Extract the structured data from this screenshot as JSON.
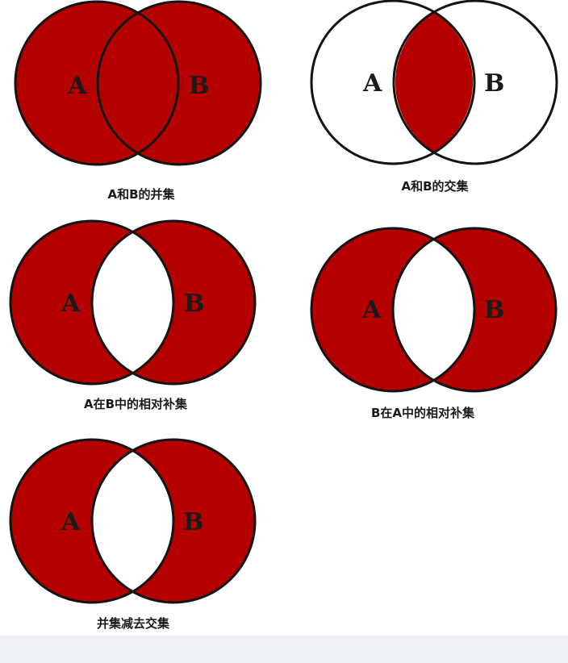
{
  "colors": {
    "fill": "#b50000",
    "stroke": "#141414",
    "label_on_fill": "#1a1a1a",
    "background": "#ffffff"
  },
  "diagrams": [
    {
      "id": "union",
      "caption": "A和B的并集",
      "label_a": "A",
      "label_b": "B",
      "shaded_regions": [
        "A only",
        "A∩B",
        "B only"
      ]
    },
    {
      "id": "intersection",
      "caption": "A和B的交集",
      "label_a": "A",
      "label_b": "B",
      "shaded_regions": [
        "A∩B"
      ]
    },
    {
      "id": "b-minus-a",
      "caption": "A在B中的相对补集",
      "label_a": "A",
      "label_b": "B",
      "shaded_regions": [
        "B only"
      ]
    },
    {
      "id": "a-minus-b",
      "caption": "B在A中的相对补集",
      "label_a": "A",
      "label_b": "B",
      "shaded_regions": [
        "A only"
      ]
    },
    {
      "id": "symmetric-difference",
      "caption": "并集减去交集",
      "label_a": "A",
      "label_b": "B",
      "shaded_regions": [
        "A only",
        "B only"
      ]
    }
  ]
}
